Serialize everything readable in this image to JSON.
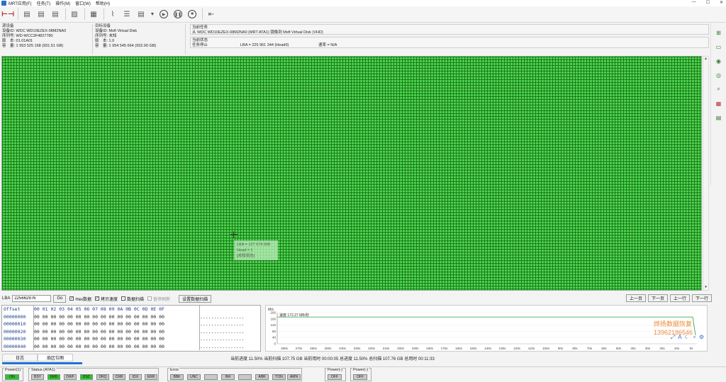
{
  "menu": [
    "MRT应用(F)",
    "任务(T)",
    "操作(M)",
    "窗口(W)",
    "帮助(H)"
  ],
  "window_controls": [
    "—",
    "☐",
    "✕"
  ],
  "source": {
    "header": "源设备",
    "model": "设备ID: WDC WD10EZEX-08M2NA0",
    "serial": "序列号: WD-WCC3F4827780",
    "version": "版　本: 01.01A01",
    "capacity": "容　量: 1 953 525 168 (931.51 GB)"
  },
  "target": {
    "header": "目标设备",
    "model": "设备ID: Msft Virtual Disk",
    "serial": "序列号: 未知",
    "version": "版　本: 1.0",
    "capacity": "容　量: 1 954 545 664 (932.00 GB)"
  },
  "task": {
    "header": "当前任务",
    "text": "从 WDC WD10EZEX-08M2NA0 (MRT ATA1) 镜像到 Msft Virtual Disk (VHD)",
    "state_header": "当前状态",
    "state": "任务停止",
    "lba": "LBA = 225 961 344 (Head0)",
    "rate": "速率 = N/A"
  },
  "tooltip": {
    "lba": "LBA = 127 574 908",
    "head": "Head = 1",
    "status": "[未知状态]"
  },
  "lba_bar": {
    "label": "LBA",
    "value": "225662976",
    "go": "Go",
    "hex_data": "Hex数据",
    "copy_speed": "拷贝速度",
    "data_scan": "数据扫描",
    "pause_refresh": "暂停刷新",
    "set_scan": "设置数据扫描"
  },
  "nav": [
    "上一页",
    "下一页",
    "上一行",
    "下一行"
  ],
  "hex": {
    "header_offset": "Offset",
    "header_bytes": "00 01 02 03 04 05 06 07 08 09 0A 0B 0C 0D 0E 0F",
    "rows": [
      {
        "offset": "00000000",
        "bytes": "00 00 00 00 00 00 00 00 00 00 00 00 00 00 00 00",
        "ascii": "................"
      },
      {
        "offset": "00000010",
        "bytes": "00 00 00 00 00 00 00 00 00 00 00 00 00 00 00 00",
        "ascii": "................"
      },
      {
        "offset": "00000020",
        "bytes": "00 00 00 00 00 00 00 00 00 00 00 00 00 00 00 00",
        "ascii": "................"
      },
      {
        "offset": "00000030",
        "bytes": "00 00 00 00 00 00 00 00 00 00 00 00 00 00 00 00",
        "ascii": "................"
      },
      {
        "offset": "00000040",
        "bytes": "00 00 00 00 00 00 00 00 00 00 00 00 00 00 00 00",
        "ascii": "................"
      }
    ]
  },
  "speed_chart": {
    "unit": "M/s",
    "speed_label": "速度 172.27 MB/秒",
    "y_ticks": [
      "200",
      "160",
      "120",
      "80",
      "40",
      "0"
    ],
    "x_ticks": [
      "280s",
      "270s",
      "260s",
      "250s",
      "240s",
      "230s",
      "220s",
      "210s",
      "200s",
      "190s",
      "180s",
      "170s",
      "160s",
      "150s",
      "140s",
      "130s",
      "120s",
      "110s",
      "100s",
      "90s",
      "80s",
      "70s",
      "60s",
      "50s",
      "40s",
      "30s",
      "20s",
      "10s",
      "0s"
    ],
    "watermark_line1": "烨扬数据恢复",
    "watermark_line2": "13962186546",
    "line_color": "#1f9c3a"
  },
  "tabs": [
    "日志",
    "扇区位图"
  ],
  "stats": "当前进度 11.50% 当前扫描 107.75 GB 当前用时 00:00:05    总进度 11.50% 总扫描 107.76 GB 总用时 00:11:33",
  "status_groups": {
    "power1": {
      "title": "Power(1)",
      "items": [
        {
          "label": "ON",
          "on": true
        }
      ]
    },
    "status": {
      "title": "Status (ATA1)",
      "items": [
        {
          "label": "BSY",
          "on": false
        },
        {
          "label": "DRD",
          "on": true
        },
        {
          "label": "DWF",
          "on": false
        },
        {
          "label": "DSC",
          "on": true
        },
        {
          "label": "DRQ",
          "on": false
        },
        {
          "label": "CRR",
          "on": false
        },
        {
          "label": "IDX",
          "on": false
        },
        {
          "label": "ERR",
          "on": false
        }
      ]
    },
    "error": {
      "title": "Error",
      "items": [
        {
          "label": "BBK",
          "on": false
        },
        {
          "label": "UNC",
          "on": false
        },
        {
          "label": "",
          "on": false
        },
        {
          "label": "INF",
          "on": false
        },
        {
          "label": "",
          "on": false
        },
        {
          "label": "ABR",
          "on": false
        },
        {
          "label": "TON",
          "on": false
        },
        {
          "label": "AMN",
          "on": false
        }
      ]
    },
    "power_a": {
      "title": "Power(-)",
      "items": [
        {
          "label": "OFF",
          "on": false
        }
      ]
    },
    "power_b": {
      "title": "Power(-)",
      "items": [
        {
          "label": "OFF",
          "on": false
        }
      ]
    }
  },
  "colors": {
    "map_good": "#4cd14c",
    "map_grid": "#146e14",
    "indicator_on": "#28c828",
    "accent": "#1e73d6"
  }
}
